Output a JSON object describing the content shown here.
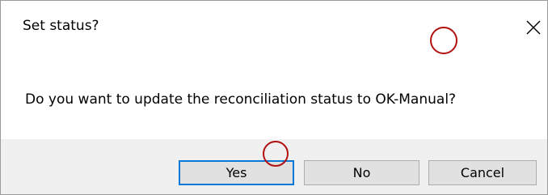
{
  "dialog": {
    "title": "Set status?",
    "close_icon": "close-icon",
    "message": "Do you want to update the reconciliation status to OK-Manual?",
    "buttons": {
      "yes_label": "Yes",
      "no_label": "No",
      "cancel_label": "Cancel"
    }
  },
  "annotations": {
    "count": 2,
    "color": "#b01010"
  },
  "colors": {
    "footer_background": "#f0f0f0",
    "default_button_border": "#0078d7",
    "button_background": "#e1e1e1"
  }
}
